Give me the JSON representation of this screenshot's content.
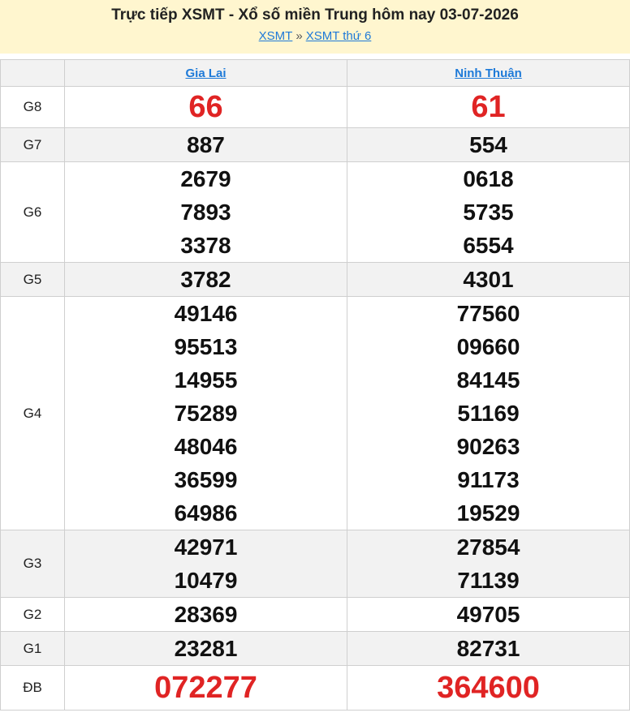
{
  "header": {
    "title": "Trực tiếp XSMT - Xổ số miền Trung hôm nay 03-07-2026",
    "crumb_home": "XSMT",
    "crumb_sep": "»",
    "crumb_day": "XSMT thứ 6"
  },
  "provinces": [
    "Gia Lai",
    "Ninh Thuận"
  ],
  "prizes": [
    {
      "label": "G8",
      "style": "big",
      "values": [
        [
          "66"
        ],
        [
          "61"
        ]
      ]
    },
    {
      "label": "G7",
      "style": "normal",
      "values": [
        [
          "887"
        ],
        [
          "554"
        ]
      ]
    },
    {
      "label": "G6",
      "style": "normal",
      "values": [
        [
          "2679",
          "7893",
          "3378"
        ],
        [
          "0618",
          "5735",
          "6554"
        ]
      ]
    },
    {
      "label": "G5",
      "style": "normal",
      "values": [
        [
          "3782"
        ],
        [
          "4301"
        ]
      ]
    },
    {
      "label": "G4",
      "style": "normal",
      "values": [
        [
          "49146",
          "95513",
          "14955",
          "75289",
          "48046",
          "36599",
          "64986"
        ],
        [
          "77560",
          "09660",
          "84145",
          "51169",
          "90263",
          "91173",
          "19529"
        ]
      ]
    },
    {
      "label": "G3",
      "style": "normal",
      "values": [
        [
          "42971",
          "10479"
        ],
        [
          "27854",
          "71139"
        ]
      ]
    },
    {
      "label": "G2",
      "style": "normal",
      "values": [
        [
          "28369"
        ],
        [
          "49705"
        ]
      ]
    },
    {
      "label": "G1",
      "style": "normal",
      "values": [
        [
          "23281"
        ],
        [
          "82731"
        ]
      ]
    },
    {
      "label": "ĐB",
      "style": "db",
      "values": [
        [
          "072277"
        ],
        [
          "364600"
        ]
      ]
    }
  ],
  "colors": {
    "special": "#e02424",
    "link": "#1e7ad8",
    "header_bg": "#fff6cf",
    "alt_row": "#f2f2f2"
  }
}
